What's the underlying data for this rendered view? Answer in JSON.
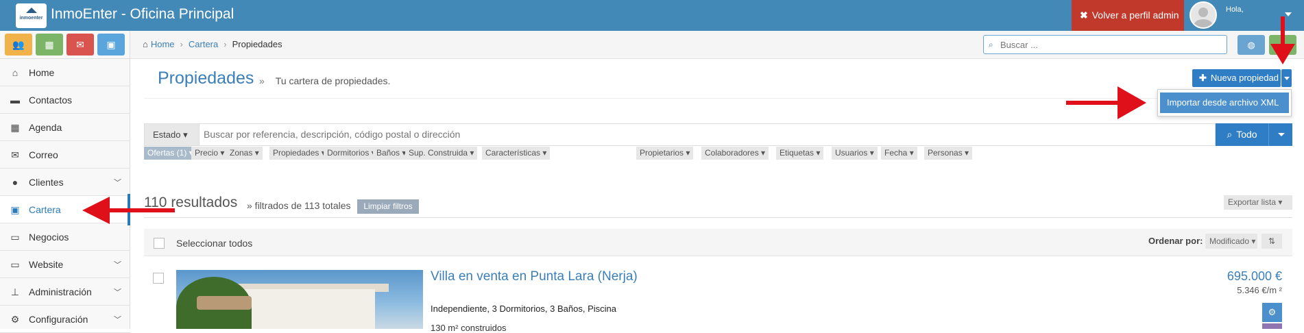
{
  "app": {
    "logo_text": "inmoenter",
    "title": "InmoEnter - Oficina Principal",
    "back_admin_label": "Volver a perfil admin",
    "greeting": "Hola,"
  },
  "quick_buttons": [
    {
      "icon": "users-icon",
      "color": "#f1b24a"
    },
    {
      "icon": "calendar-icon",
      "color": "#7cb567"
    },
    {
      "icon": "envelope-icon",
      "color": "#d9534f"
    },
    {
      "icon": "briefcase-icon",
      "color": "#5aa6dc"
    }
  ],
  "sidebar": {
    "items": [
      {
        "label": "Home",
        "icon": "home-icon"
      },
      {
        "label": "Contactos",
        "icon": "comment-icon"
      },
      {
        "label": "Agenda",
        "icon": "calendar-icon"
      },
      {
        "label": "Correo",
        "icon": "envelope-icon"
      },
      {
        "label": "Clientes",
        "icon": "users-icon",
        "expandable": true
      },
      {
        "label": "Cartera",
        "icon": "briefcase-icon",
        "active": true
      },
      {
        "label": "Negocios",
        "icon": "money-icon"
      },
      {
        "label": "Website",
        "icon": "monitor-icon",
        "expandable": true
      },
      {
        "label": "Administración",
        "icon": "sitemap-icon",
        "expandable": true
      },
      {
        "label": "Configuración",
        "icon": "gears-icon",
        "expandable": true
      }
    ]
  },
  "breadcrumb": {
    "items": [
      "Home",
      "Cartera",
      "Propiedades"
    ]
  },
  "search": {
    "placeholder": "Buscar ..."
  },
  "page": {
    "title": "Propiedades",
    "separator": "»",
    "subtitle": "Tu cartera de propiedades.",
    "new_button": "Nueva propiedad",
    "dropdown_item": "Importar desde archivo XML"
  },
  "filter_bar": {
    "estado_label": "Estado",
    "search_placeholder": "Buscar por referencia, descripción, código postal o dirección",
    "scope_button": "Todo"
  },
  "filters": [
    {
      "label": "Ofertas (1)",
      "active": true
    },
    {
      "label": "Precio"
    },
    {
      "label": "Zonas"
    },
    {
      "label": "Propiedades"
    },
    {
      "label": "Dormitorios"
    },
    {
      "label": "Baños"
    },
    {
      "label": "Sup. Construida"
    },
    {
      "label": "Características"
    },
    {
      "label": "Propietarios"
    },
    {
      "label": "Colaboradores"
    },
    {
      "label": "Etiquetas"
    },
    {
      "label": "Usuarios"
    },
    {
      "label": "Fecha"
    },
    {
      "label": "Personas"
    }
  ],
  "results": {
    "count_text": "110 resultados",
    "filtered_text": "» filtrados de 113 totales",
    "clear_filters": "Limpiar filtros",
    "export": "Exportar lista"
  },
  "list_header": {
    "select_all": "Seleccionar todos",
    "order_by": "Ordenar por:",
    "order_value": "Modificado"
  },
  "property": {
    "title": "Villa en venta en Punta Lara (Nerja)",
    "features": "Independiente, 3 Dormitorios, 3 Baños, Piscina",
    "built": "130 m² construidos",
    "price": "695.000 €",
    "price_per_m2": "5.346 €/m ²"
  },
  "colors": {
    "topbar": "#4389b7",
    "admin_button": "#c0392b",
    "primary": "#2f7dc5",
    "arrow": "#e0101a"
  }
}
